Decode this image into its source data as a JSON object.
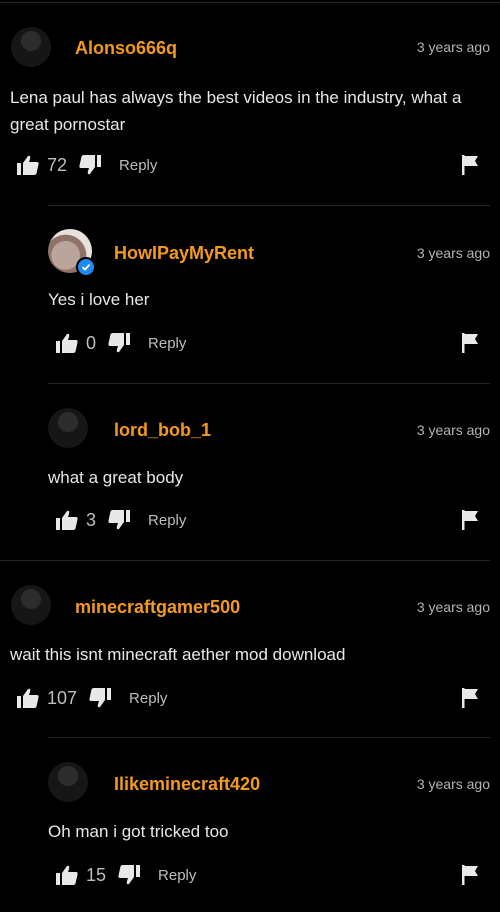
{
  "colors": {
    "background": "#000000",
    "username": "#f39a1e",
    "text": "#e8e8e8",
    "muted": "#b3b3b3",
    "verified": "#1d8cf0"
  },
  "icons": {
    "like": "thumbs-up-icon",
    "dislike": "thumbs-down-icon",
    "report": "flag-icon",
    "verified": "verified-check-icon"
  },
  "comments": [
    {
      "username": "Alonso666q",
      "time": "3 years ago",
      "text": "Lena paul has always the best videos in the industry, what a great pornostar",
      "likes": "72",
      "reply_label": "Reply"
    },
    {
      "username": "HowIPayMyRent",
      "time": "3 years ago",
      "text": "Yes i love her",
      "likes": "0",
      "reply_label": "Reply",
      "verified": true
    },
    {
      "username": "lord_bob_1",
      "time": "3 years ago",
      "text": "what a great body",
      "likes": "3",
      "reply_label": "Reply"
    },
    {
      "username": "minecraftgamer500",
      "time": "3 years ago",
      "text": "wait this isnt minecraft aether mod download",
      "likes": "107",
      "reply_label": "Reply"
    },
    {
      "username": "Ilikeminecraft420",
      "time": "3 years ago",
      "text": "Oh man i got tricked too",
      "likes": "15",
      "reply_label": "Reply"
    }
  ]
}
